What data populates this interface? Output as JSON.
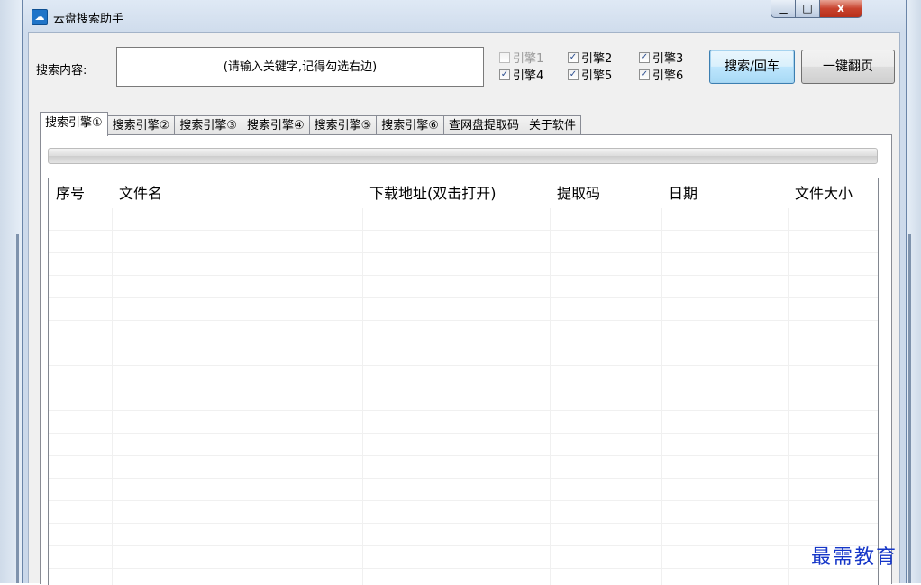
{
  "window": {
    "title": "云盘搜索助手",
    "icon": "cloud-disk-icon",
    "controls": [
      "minimize-icon",
      "maximize-icon",
      "close-icon"
    ],
    "close_glyph": "x"
  },
  "search": {
    "label": "搜索内容:",
    "placeholder": "(请输入关键字,记得勾选右边)",
    "value": ""
  },
  "engines": [
    {
      "label": "引擎1",
      "checked": false,
      "enabled": false
    },
    {
      "label": "引擎2",
      "checked": true,
      "enabled": true
    },
    {
      "label": "引擎3",
      "checked": true,
      "enabled": true
    },
    {
      "label": "引擎4",
      "checked": true,
      "enabled": true
    },
    {
      "label": "引擎5",
      "checked": true,
      "enabled": true
    },
    {
      "label": "引擎6",
      "checked": true,
      "enabled": true
    }
  ],
  "buttons": {
    "search": "搜索/回车",
    "page_turn": "一键翻页"
  },
  "tabs": [
    {
      "label": "搜索引擎①",
      "active": true
    },
    {
      "label": "搜索引擎②",
      "active": false
    },
    {
      "label": "搜索引擎③",
      "active": false
    },
    {
      "label": "搜索引擎④",
      "active": false
    },
    {
      "label": "搜索引擎⑤",
      "active": false
    },
    {
      "label": "搜索引擎⑥",
      "active": false
    },
    {
      "label": "查网盘提取码",
      "active": false
    },
    {
      "label": "关于软件",
      "active": false
    }
  ],
  "progress": {
    "value": 0
  },
  "table": {
    "columns": [
      "序号",
      "文件名",
      "下载地址(双击打开)",
      "提取码",
      "日期",
      "文件大小"
    ],
    "rows": []
  },
  "watermark": "最需教育",
  "colors": {
    "accent": "#3c7fb1",
    "close_button": "#c8432e",
    "watermark": "#1536c8"
  }
}
